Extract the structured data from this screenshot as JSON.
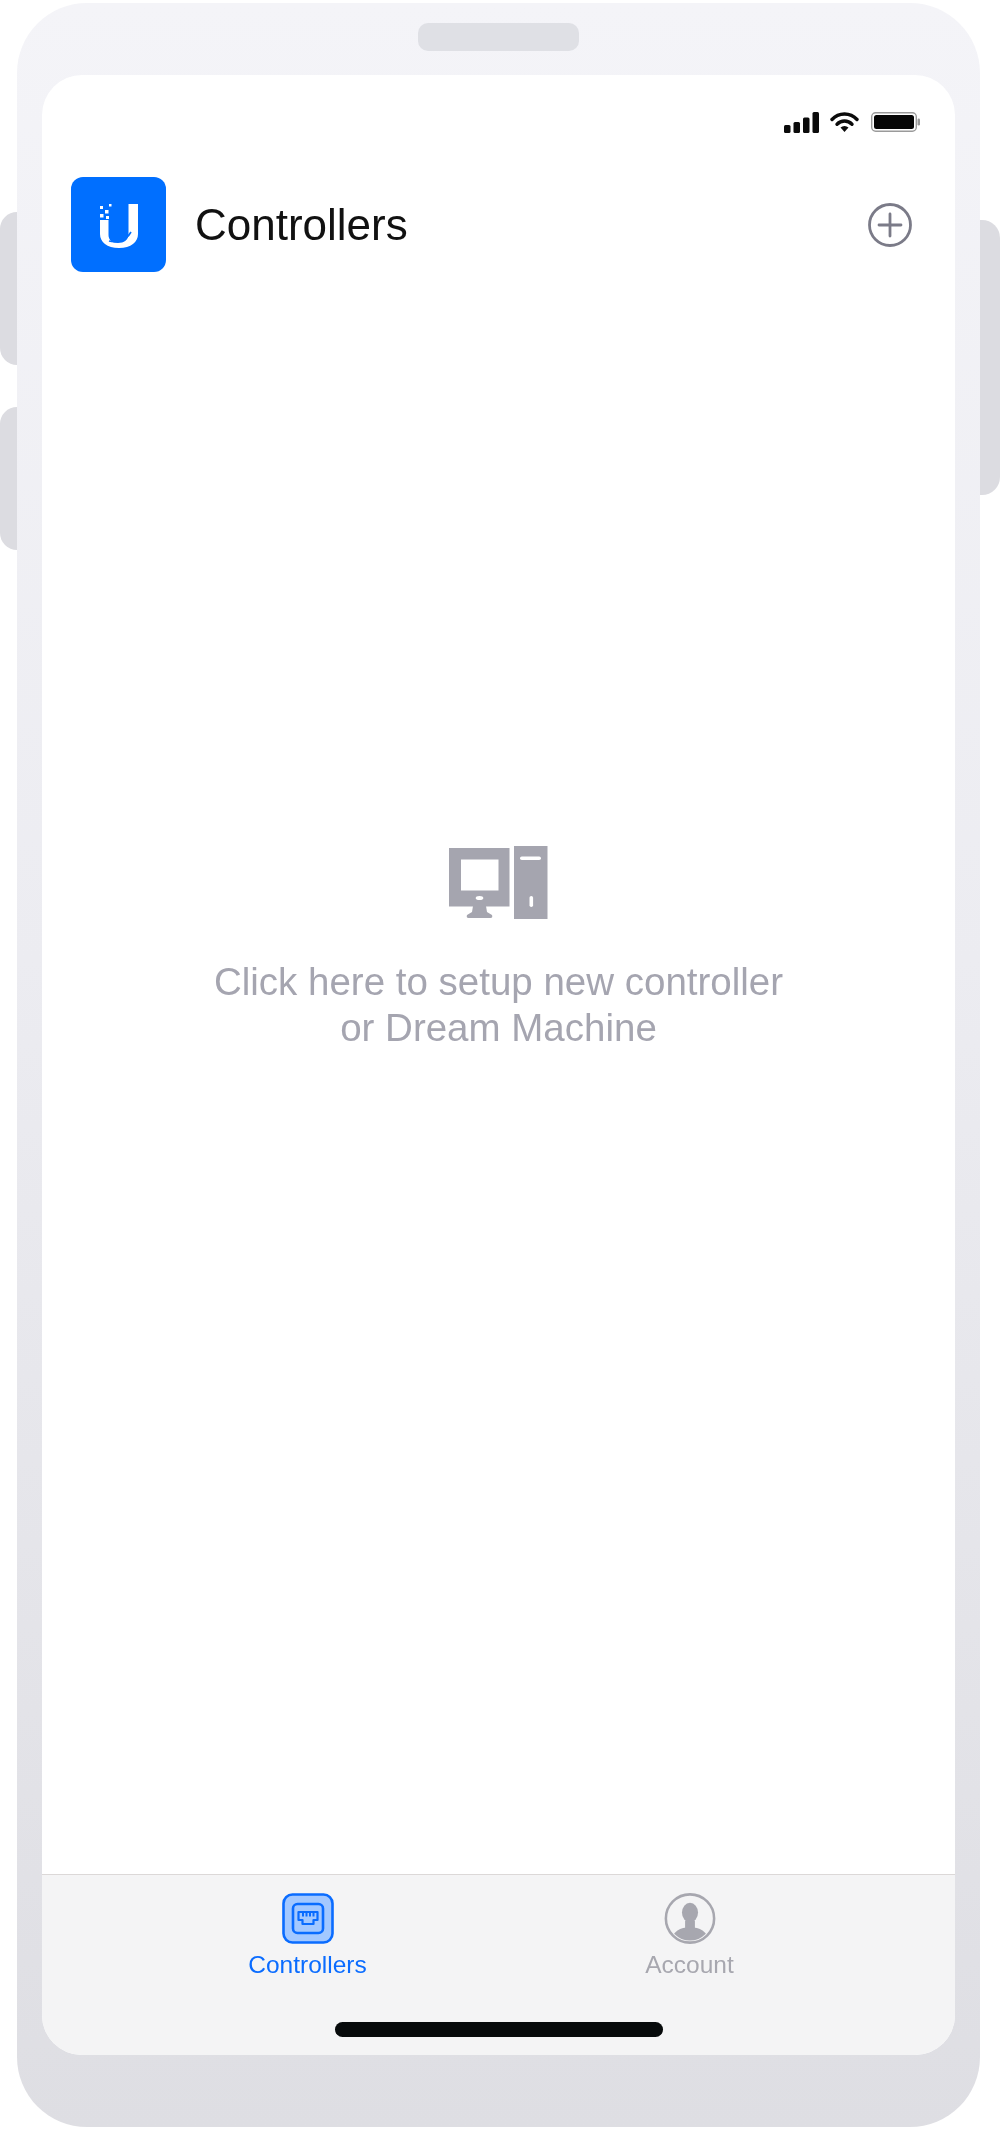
{
  "header": {
    "title": "Controllers"
  },
  "empty_state": {
    "message": "Click here to setup new controller or Dream Machine"
  },
  "tab_bar": {
    "tabs": [
      {
        "kind": "network",
        "label": "Controllers",
        "selected": true
      },
      {
        "kind": "person",
        "label": "Account",
        "selected": false
      }
    ]
  }
}
